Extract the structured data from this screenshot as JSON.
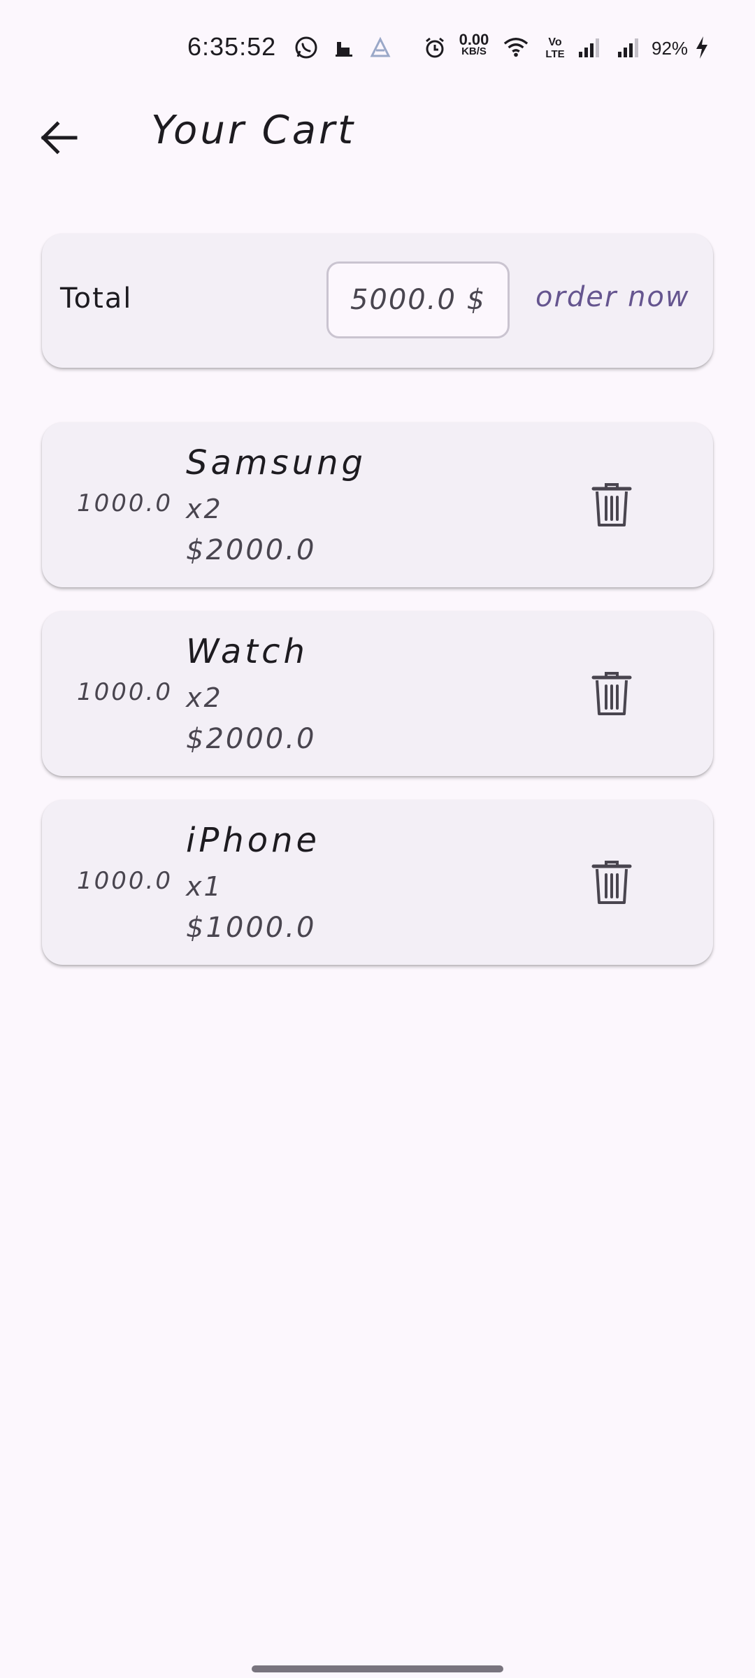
{
  "status_bar": {
    "time": "6:35:52",
    "net_speed_value": "0.00",
    "net_speed_unit": "KB/S",
    "volte_top": "Vo",
    "volte_bottom": "LTE",
    "battery": "92%"
  },
  "app_bar": {
    "title": "Your Cart"
  },
  "total_card": {
    "label": "Total",
    "value": "5000.0 $",
    "order_label": "order now",
    "accent_color": "#65558f"
  },
  "items": [
    {
      "price": "1000.0",
      "name": "Samsung",
      "qty": "x2",
      "subtotal": "$2000.0"
    },
    {
      "price": "1000.0",
      "name": "Watch",
      "qty": "x2",
      "subtotal": "$2000.0"
    },
    {
      "price": "1000.0",
      "name": "iPhone",
      "qty": "x1",
      "subtotal": "$1000.0"
    }
  ],
  "icons": {
    "back": "arrow-back-icon",
    "delete": "trash-icon"
  }
}
